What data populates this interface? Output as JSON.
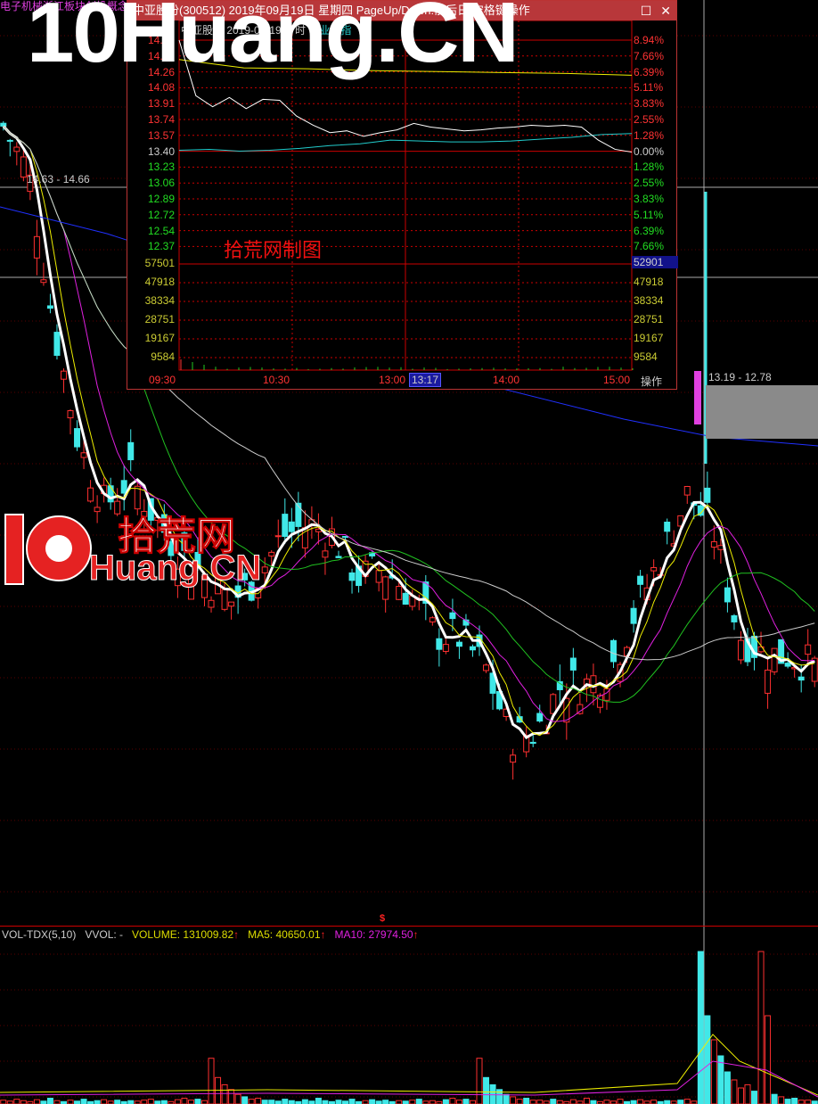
{
  "watermark": "10Huang.CN",
  "logo": {
    "cn": "拾荒网",
    "en": "Huang.CN",
    "num": "10"
  },
  "main": {
    "top_info": "电子机械浙江板块创投概念 C...",
    "range_label_1": "14.63 - 14.66",
    "range_label_2": "13.19 - 12.78"
  },
  "chart_data": {
    "type": "candlestick",
    "ma_keypoints_price": [
      15.1,
      14.7,
      13.4,
      12.4,
      11.9,
      12.15,
      11.8,
      11.5,
      11.3,
      11.1,
      11.3,
      11.65,
      11.75,
      11.65,
      11.3,
      11.38,
      11.18,
      10.83,
      10.8,
      10.55,
      9.96,
      10.0,
      10.4,
      10.4,
      10.55,
      11.05,
      11.5,
      12.0,
      11.7,
      10.83,
      10.65,
      10.65,
      10.55
    ],
    "volume": {
      "values_rel": [
        0.08,
        0.06,
        0.1,
        0.07,
        0.05,
        0.09,
        0.06,
        0.12,
        0.07,
        0.05,
        0.08,
        0.06,
        0.1,
        0.05,
        0.07,
        0.09,
        0.06,
        0.08,
        0.05,
        0.07,
        0.06,
        0.08,
        0.1,
        0.06,
        0.07,
        0.05,
        0.09,
        0.12,
        0.08,
        0.1,
        0.07,
        0.95,
        0.55,
        0.4,
        0.3,
        0.2,
        0.15,
        0.1,
        0.12,
        0.08
      ]
    }
  },
  "volume_bar": {
    "name": "VOL-TDX(5,10)",
    "vvol": "VVOL: -",
    "volume": "VOLUME: 131009.82",
    "ma5": "MA5: 40650.01",
    "ma10": "MA10: 27974.50",
    "arrow": "↑",
    "marker": "$"
  },
  "popup": {
    "title": "中亚股份(300512) 2019年09月19日 星期四 PageUp/Down:前后日 空格键操作",
    "subtitle": "中亚股份  2019-09-19 分时",
    "index": "创业板指",
    "stamp": "拾荒网制图",
    "price_labels": [
      "14.60",
      "14.43",
      "14.26",
      "14.08",
      "13.91",
      "13.74",
      "13.57",
      "13.40",
      "13.23",
      "13.06",
      "12.89",
      "12.72",
      "12.54",
      "12.37"
    ],
    "pct_labels": [
      "8.94%",
      "7.66%",
      "6.39%",
      "5.11%",
      "3.83%",
      "2.55%",
      "1.28%",
      "0.00%",
      "1.28%",
      "2.55%",
      "3.83%",
      "5.11%",
      "6.39%",
      "7.66%"
    ],
    "vol_labels": [
      "57501",
      "47918",
      "38334",
      "28751",
      "19167",
      "9584"
    ],
    "vol_right_top": "52901",
    "time_labels": [
      "09:30",
      "10:30",
      "13:00",
      "14:00",
      "15:00"
    ],
    "cursor_time": "13:17",
    "op_label": "操作",
    "price_line": [
      14.6,
      14.0,
      13.88,
      13.98,
      13.86,
      13.96,
      13.95,
      13.78,
      13.68,
      13.6,
      13.62,
      13.56,
      13.6,
      13.63,
      13.7,
      13.66,
      13.64,
      13.62,
      13.63,
      13.65,
      13.66,
      13.68,
      13.67,
      13.68,
      13.66,
      13.52,
      13.42,
      13.39
    ],
    "avg_line": [
      13.41,
      13.42,
      13.4,
      13.41,
      13.43,
      13.46,
      13.48,
      13.52,
      13.51,
      13.5,
      13.5,
      13.51,
      13.53,
      13.55,
      13.58,
      13.59
    ],
    "index_line": [
      14.39,
      14.3,
      14.29,
      14.27,
      14.26,
      14.25,
      14.24,
      14.22
    ]
  }
}
